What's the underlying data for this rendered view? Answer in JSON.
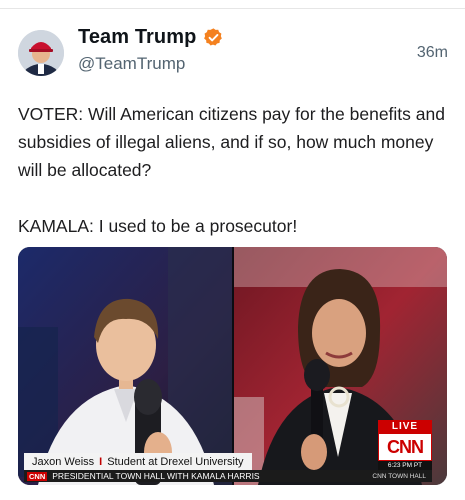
{
  "account": {
    "display_name": "Team Trump",
    "handle": "@TeamTrump",
    "timestamp": "36m",
    "verified_icon": "verified-badge-icon",
    "verified_color": "#f4811f"
  },
  "post": {
    "line1": "VOTER: Will American citizens pay for the benefits and subsidies of illegal aliens, and if so, how much money will be allocated?",
    "line2": "KAMALA: I used to be a prosecutor!"
  },
  "media": {
    "lower_third_name": "Jaxon Weiss",
    "lower_third_separator": "I",
    "lower_third_role": "Student at Drexel University",
    "ticker_network": "CNN",
    "ticker_text": "PRESIDENTIAL TOWN HALL WITH KAMALA HARRIS",
    "ticker_right": "CNN TOWN HALL",
    "live_label": "LIVE",
    "network_logo": "CNN",
    "clock": "6:23 PM PT",
    "brand_color": "#cc0000"
  }
}
